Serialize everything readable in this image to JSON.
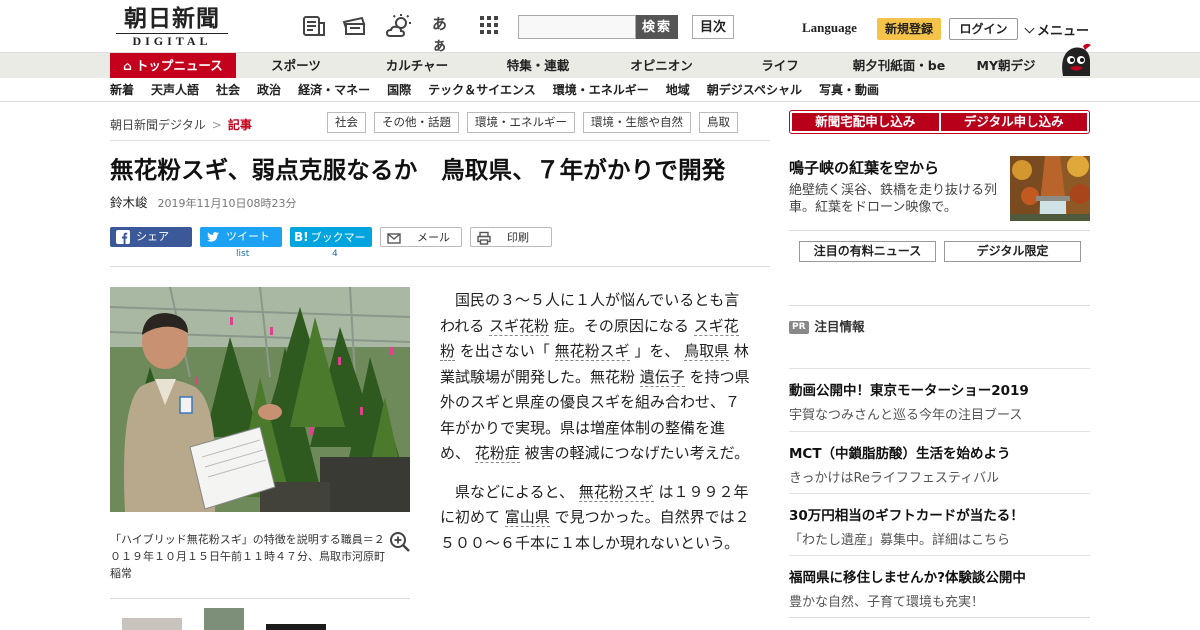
{
  "header": {
    "logo_main": "朝日新聞",
    "logo_sub": "DIGITAL",
    "font_size_icon_label": "あぁ",
    "search_button": "検索",
    "search_placeholder": "",
    "toc_button": "目次",
    "language": "Language",
    "register": "新規登録",
    "login": "ログイン",
    "menu": "メニュー"
  },
  "nav_primary": [
    {
      "label": "トップニュース",
      "active": true
    },
    {
      "label": "スポーツ"
    },
    {
      "label": "カルチャー"
    },
    {
      "label": "特集・連載"
    },
    {
      "label": "オピニオン"
    },
    {
      "label": "ライフ"
    },
    {
      "label": "朝夕刊紙面・be"
    },
    {
      "label": "MY朝デジ"
    }
  ],
  "nav_secondary": [
    "新着",
    "天声人語",
    "社会",
    "政治",
    "経済・マネー",
    "国際",
    "テック＆サイエンス",
    "環境・エネルギー",
    "地域",
    "朝デジスペシャル",
    "写真・動画"
  ],
  "breadcrumb": {
    "home": "朝日新聞デジタル",
    "sep": ">",
    "current": "記事"
  },
  "tags": [
    "社会",
    "その他・話題",
    "環境・エネルギー",
    "環境・生態や自然",
    "鳥取"
  ],
  "article": {
    "headline": "無花粉スギ、弱点克服なるか　鳥取県、７年がかりで開発",
    "author": "鈴木峻",
    "date": "2019年11月10日08時23分",
    "share": {
      "facebook": "シェア",
      "twitter": "ツイート",
      "twitter_count": "list",
      "hatena": "ブックマーク",
      "hatena_count": "4",
      "mail": "メール",
      "print": "印刷"
    },
    "caption": "「ハイブリッド無花粉スギ」の特徴を説明する職員＝２０１９年１０月１５日午前１１時４７分、鳥取市河原町稲常",
    "p1": {
      "a": "国民の３～５人に１人が悩んでいるとも言われる ",
      "k1": "スギ花粉",
      "b": " 症。その原因になる ",
      "k2": "スギ花粉",
      "c": " を出さない「 ",
      "k3": "無花粉スギ",
      "d": " 」を、 ",
      "k4": "鳥取県",
      "e": " 林業試験場が開発した。無花粉 ",
      "k5": "遺伝子",
      "f": " を持つ県外のスギと県産の優良スギを組み合わせ、７年がかりで実現。県は増産体制の整備を進め、 ",
      "k6": "花粉症",
      "g": " 被害の軽減につなげたい考えだ。"
    },
    "p2": {
      "a": "県などによると、 ",
      "k1": "無花粉スギ",
      "b": " は１９９２年に初めて ",
      "k2": "富山県",
      "c": " で見つかった。自然界では２５００～６千本に１本しか現れないという。"
    }
  },
  "sidebar": {
    "sub_home": "新聞宅配申し込み",
    "sub_digital": "デジタル申し込み",
    "promo_title": "鳴子峡の紅葉を空から",
    "promo_text": "絶壁続く渓谷、鉄橋を走り抜ける列車。紅葉をドローン映像で。",
    "btn_paid": "注目の有料ニュース",
    "btn_digital": "デジタル限定",
    "pr_badge": "PR",
    "pr_head": "注目情報",
    "pr_items": [
      {
        "title": "動画公開中！東京モーターショー2019",
        "desc": "宇賀なつみさんと巡る今年の注目ブース"
      },
      {
        "title": "MCT（中鎖脂肪酸）生活を始めよう",
        "desc": "きっかけはReライフフェスティバル"
      },
      {
        "title": "30万円相当のギフトカードが当たる！",
        "desc": "「わたし遺産」募集中。詳細はこちら"
      },
      {
        "title": "福岡県に移住しませんか?体験談公開中",
        "desc": "豊かな自然、子育て環境も充実！"
      }
    ]
  }
}
